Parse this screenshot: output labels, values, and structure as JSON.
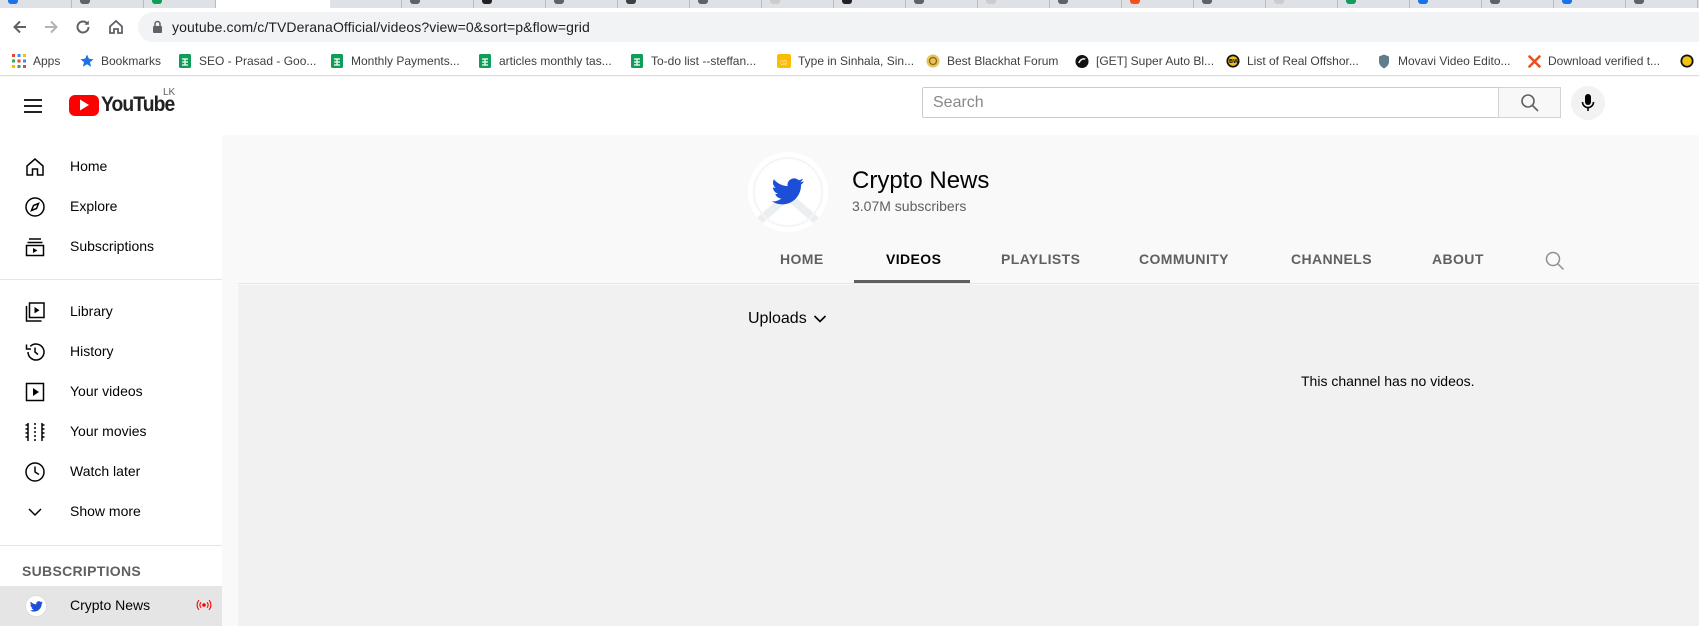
{
  "browser": {
    "url": "youtube.com/c/TVDeranaOfficial/videos?view=0&sort=p&flow=grid",
    "bookmarks": [
      {
        "label": "Apps",
        "icon": "apps-grid-icon"
      },
      {
        "label": "Bookmarks",
        "icon": "star-icon"
      },
      {
        "label": "SEO - Prasad - Goo...",
        "icon": "sheets-icon"
      },
      {
        "label": "Monthly Payments...",
        "icon": "sheets-icon"
      },
      {
        "label": "articles monthly tas...",
        "icon": "sheets-icon"
      },
      {
        "label": "To-do list --steffan...",
        "icon": "sheets-icon"
      },
      {
        "label": "Type in Sinhala, Sin...",
        "icon": "sinhala-icon"
      },
      {
        "label": "Best Blackhat Forum",
        "icon": "bhw-icon"
      },
      {
        "label": "[GET] Super Auto Bl...",
        "icon": "black-circle-icon"
      },
      {
        "label": "List of Real Offshor...",
        "icon": "bw-icon"
      },
      {
        "label": "Movavi Video Edito...",
        "icon": "movavi-icon"
      },
      {
        "label": "Download verified t...",
        "icon": "x-icon"
      }
    ]
  },
  "header": {
    "logo_text": "YouTube",
    "country_code": "LK",
    "search_placeholder": "Search"
  },
  "sidebar": {
    "main": [
      {
        "label": "Home",
        "icon": "home-icon"
      },
      {
        "label": "Explore",
        "icon": "compass-icon"
      },
      {
        "label": "Subscriptions",
        "icon": "subscriptions-icon"
      }
    ],
    "library": [
      {
        "label": "Library",
        "icon": "library-icon"
      },
      {
        "label": "History",
        "icon": "history-icon"
      },
      {
        "label": "Your videos",
        "icon": "your-videos-icon"
      },
      {
        "label": "Your movies",
        "icon": "movies-icon"
      },
      {
        "label": "Watch later",
        "icon": "clock-icon"
      },
      {
        "label": "Show more",
        "icon": "chevron-down-icon"
      }
    ],
    "subscriptions_header": "SUBSCRIPTIONS",
    "subscriptions": [
      {
        "label": "Crypto News",
        "icon": "live-icon"
      }
    ]
  },
  "channel": {
    "name": "Crypto News",
    "subscribers": "3.07M subscribers",
    "tabs": [
      "HOME",
      "VIDEOS",
      "PLAYLISTS",
      "COMMUNITY",
      "CHANNELS",
      "ABOUT"
    ],
    "active_tab": "VIDEOS"
  },
  "content": {
    "sort_label": "Uploads",
    "empty_message": "This channel has no videos."
  },
  "colors": {
    "yt_red": "#ff0000",
    "twitter_blue": "#1d4ed8"
  }
}
